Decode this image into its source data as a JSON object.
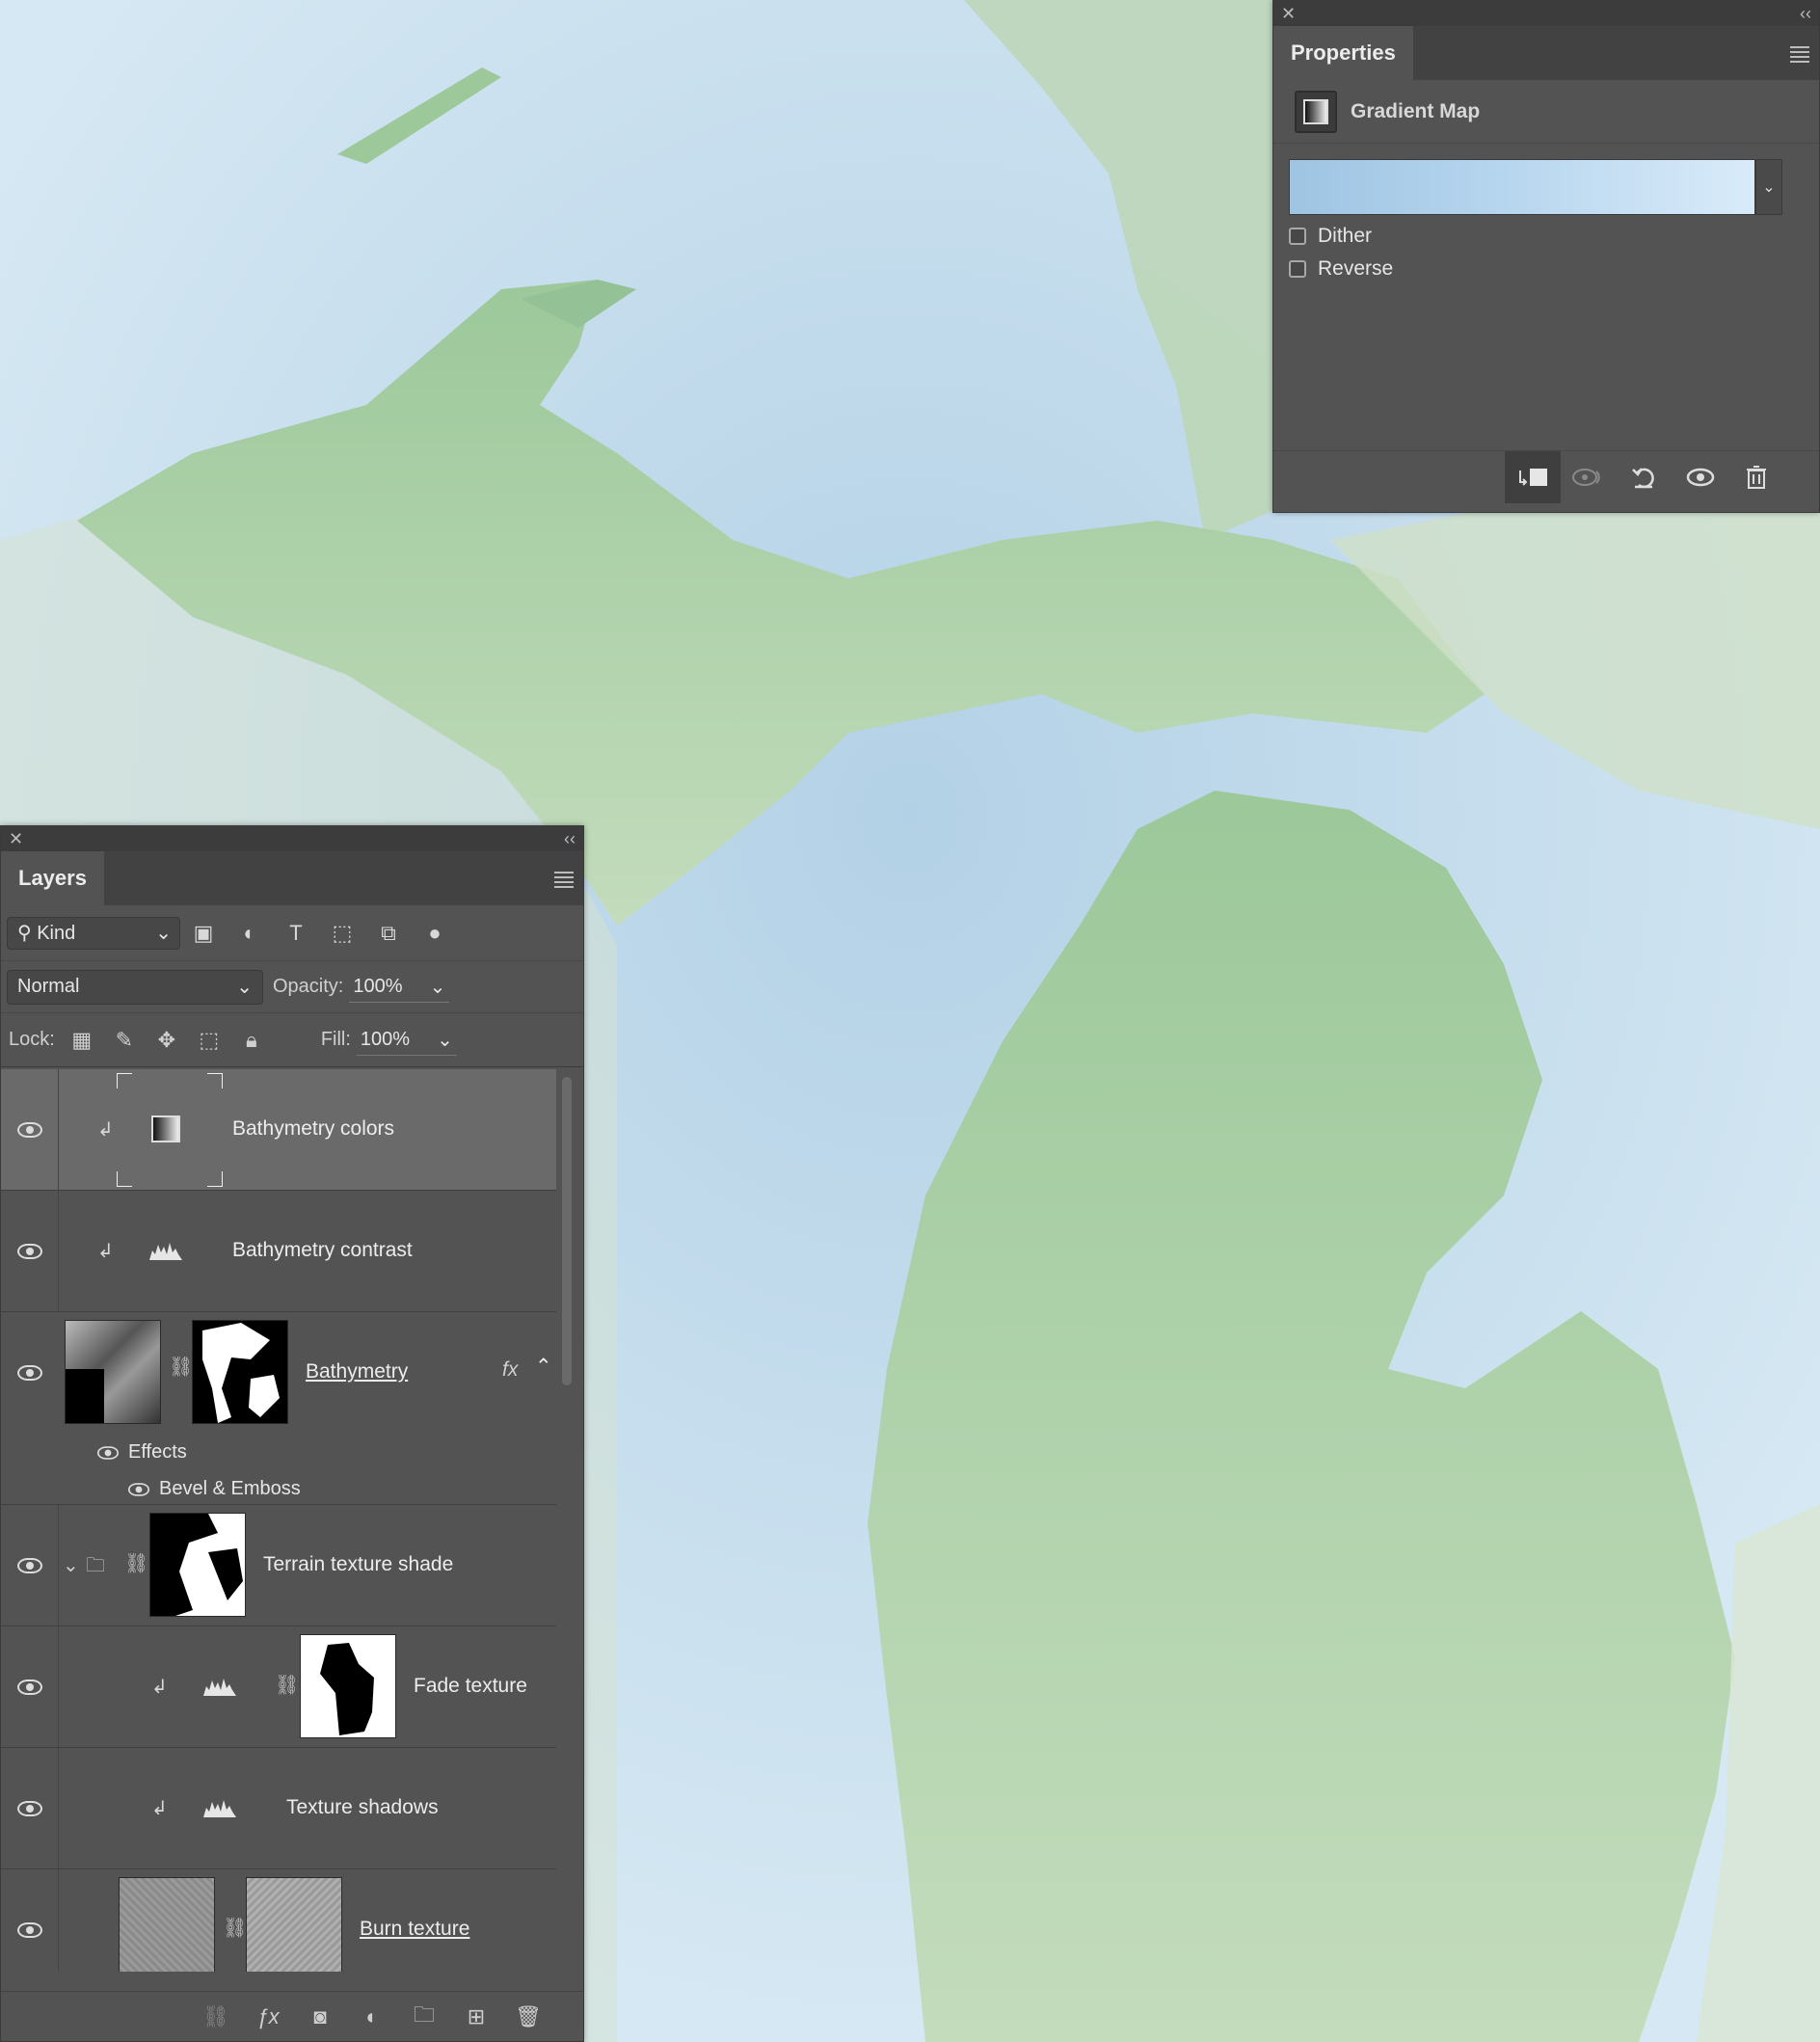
{
  "properties": {
    "tab_label": "Properties",
    "adjustment_label": "Gradient Map",
    "gradient_colors": [
      "#9ec4e2",
      "#d9ebf9"
    ],
    "options": [
      {
        "label": "Dither",
        "checked": false
      },
      {
        "label": "Reverse",
        "checked": false
      }
    ],
    "footer_icons": [
      "clip-to-layer-icon",
      "view-previous-state-icon",
      "reset-icon",
      "visibility-icon",
      "delete-icon"
    ]
  },
  "layers": {
    "tab_label": "Layers",
    "filter_kind": "Kind",
    "blend_mode": "Normal",
    "opacity_label": "Opacity:",
    "opacity_value": "100%",
    "lock_label": "Lock:",
    "fill_label": "Fill:",
    "fill_value": "100%",
    "items": [
      {
        "name": "Bathymetry colors",
        "selected": true
      },
      {
        "name": "Bathymetry contrast"
      },
      {
        "name": "Bathymetry",
        "fx": "fx"
      },
      {
        "name": "Terrain texture shade"
      },
      {
        "name": "Fade texture"
      },
      {
        "name": "Texture shadows"
      },
      {
        "name": "Burn texture"
      }
    ],
    "effects_label": "Effects",
    "effect_items": [
      "Bevel & Emboss"
    ],
    "bottom_icons": [
      "link-layers-icon",
      "fx-icon",
      "mask-icon",
      "adjustment-icon",
      "group-folder-icon",
      "new-layer-icon",
      "delete-icon"
    ]
  },
  "colors": {
    "panel_bg": "#535353",
    "water": "#cfe2ef",
    "land": "#a9cf9f"
  }
}
